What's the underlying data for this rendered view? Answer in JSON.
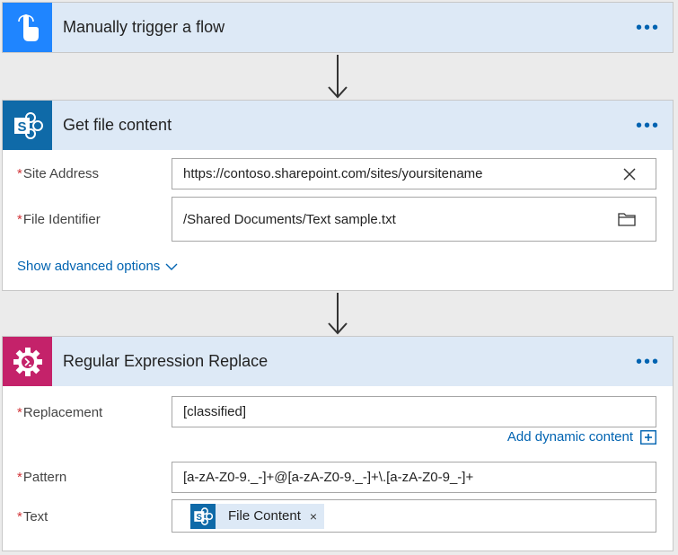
{
  "trigger": {
    "title": "Manually trigger a flow",
    "more": "•••",
    "icon": "hand-tap-icon",
    "color": "#1f85ff"
  },
  "get_file": {
    "title": "Get file content",
    "more": "•••",
    "icon": "sharepoint-icon",
    "color": "#0f6aa8",
    "fields": {
      "site_address": {
        "label": "Site Address",
        "value": "https://contoso.sharepoint.com/sites/yoursitename"
      },
      "file_identifier": {
        "label": "File Identifier",
        "value": "/Shared Documents/Text sample.txt"
      }
    },
    "advanced": "Show advanced options"
  },
  "regex": {
    "title": "Regular Expression Replace",
    "more": "•••",
    "icon": "gear-icon",
    "color": "#c4226a",
    "fields": {
      "replacement": {
        "label": "Replacement",
        "value": "[classified]"
      },
      "pattern": {
        "label": "Pattern",
        "value": "[a-zA-Z0-9._-]+@[a-zA-Z0-9._-]+\\.[a-zA-Z0-9_-]+"
      },
      "text": {
        "label": "Text",
        "token": "File Content",
        "token_remove": "×"
      }
    },
    "dynamic_content": "Add dynamic content"
  },
  "required_marker": "*"
}
